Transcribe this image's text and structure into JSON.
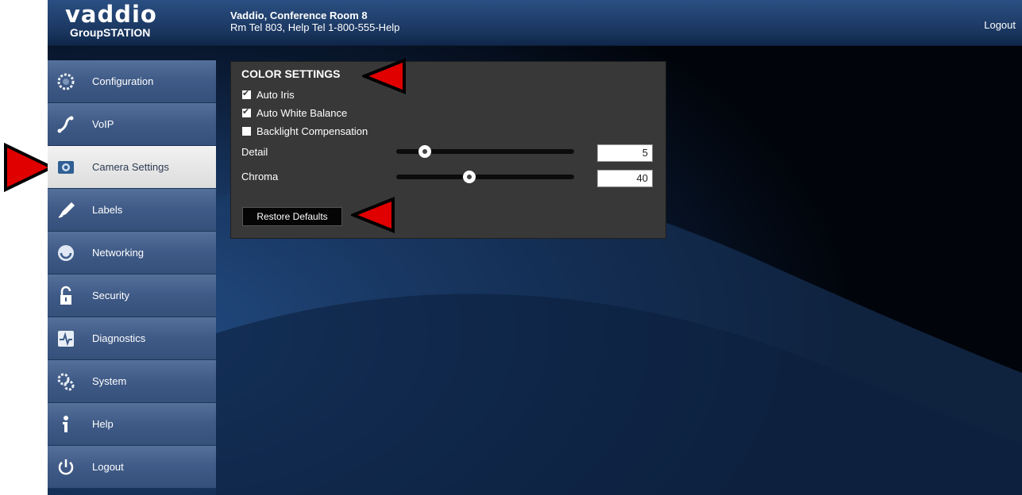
{
  "header": {
    "logo_word": "vaddio",
    "logo_sub": "GroupSTATION",
    "line1": "Vaddio, Conference Room 8",
    "line2": "Rm Tel 803, Help Tel 1-800-555-Help",
    "logout": "Logout"
  },
  "sidebar": {
    "items": [
      {
        "label": "Configuration",
        "icon": "gears-icon"
      },
      {
        "label": "VoIP",
        "icon": "phone-icon"
      },
      {
        "label": "Camera Settings",
        "icon": "camera-icon",
        "active": true
      },
      {
        "label": "Labels",
        "icon": "pen-icon"
      },
      {
        "label": "Networking",
        "icon": "network-icon"
      },
      {
        "label": "Security",
        "icon": "lock-icon"
      },
      {
        "label": "Diagnostics",
        "icon": "pulse-icon"
      },
      {
        "label": "System",
        "icon": "system-gears-icon"
      },
      {
        "label": "Help",
        "icon": "info-icon"
      },
      {
        "label": "Logout",
        "icon": "power-icon"
      }
    ]
  },
  "color_settings": {
    "title": "COLOR SETTINGS",
    "checkboxes": [
      {
        "label": "Auto Iris",
        "checked": true
      },
      {
        "label": "Auto White Balance",
        "checked": true
      },
      {
        "label": "Backlight Compensation",
        "checked": false
      }
    ],
    "sliders": [
      {
        "label": "Detail",
        "value": "5",
        "position": 0.16
      },
      {
        "label": "Chroma",
        "value": "40",
        "position": 0.41
      }
    ],
    "restore_button": "Restore Defaults"
  },
  "colors": {
    "annotation_arrow": "#e00000",
    "panel_bg": "#383838",
    "header_bg": "#1f3d6b"
  }
}
